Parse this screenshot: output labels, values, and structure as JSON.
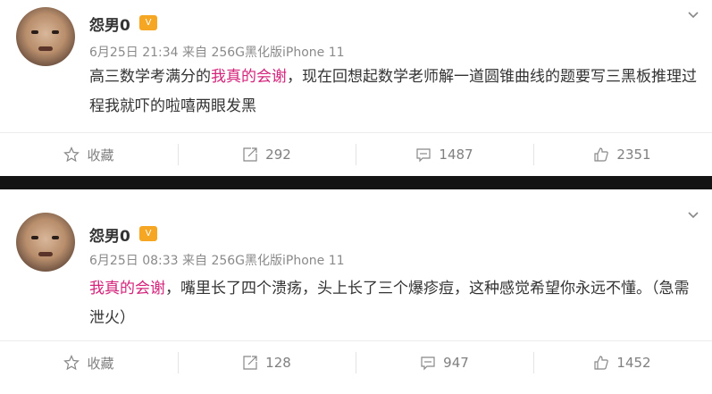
{
  "posts": [
    {
      "username": "怨男0",
      "vip_label": "V",
      "date": "6月25日",
      "time": "21:34",
      "source_prefix": "来自",
      "source": "256G黑化版iPhone 11",
      "content_before": "高三数学考满分的",
      "content_highlight": "我真的会谢",
      "content_after": "，现在回想起数学老师解一道圆锥曲线的题要写三黑板推理过程我就吓的啦嘻两眼发黑",
      "actions": {
        "favorite": "收藏",
        "reposts": "292",
        "comments": "1487",
        "likes": "2351"
      }
    },
    {
      "username": "怨男0",
      "vip_label": "V",
      "date": "6月25日",
      "time": "08:33",
      "source_prefix": "来自",
      "source": "256G黑化版iPhone 11",
      "content_before": "",
      "content_highlight": "我真的会谢",
      "content_after": "，嘴里长了四个溃疡，头上长了三个爆疹痘，这种感觉希望你永远不懂。（急需泄火）",
      "actions": {
        "favorite": "收藏",
        "reposts": "128",
        "comments": "947",
        "likes": "1452"
      }
    }
  ],
  "colors": {
    "highlight": "#d4237a",
    "vip": "#f5a623",
    "separator": "#141414"
  }
}
